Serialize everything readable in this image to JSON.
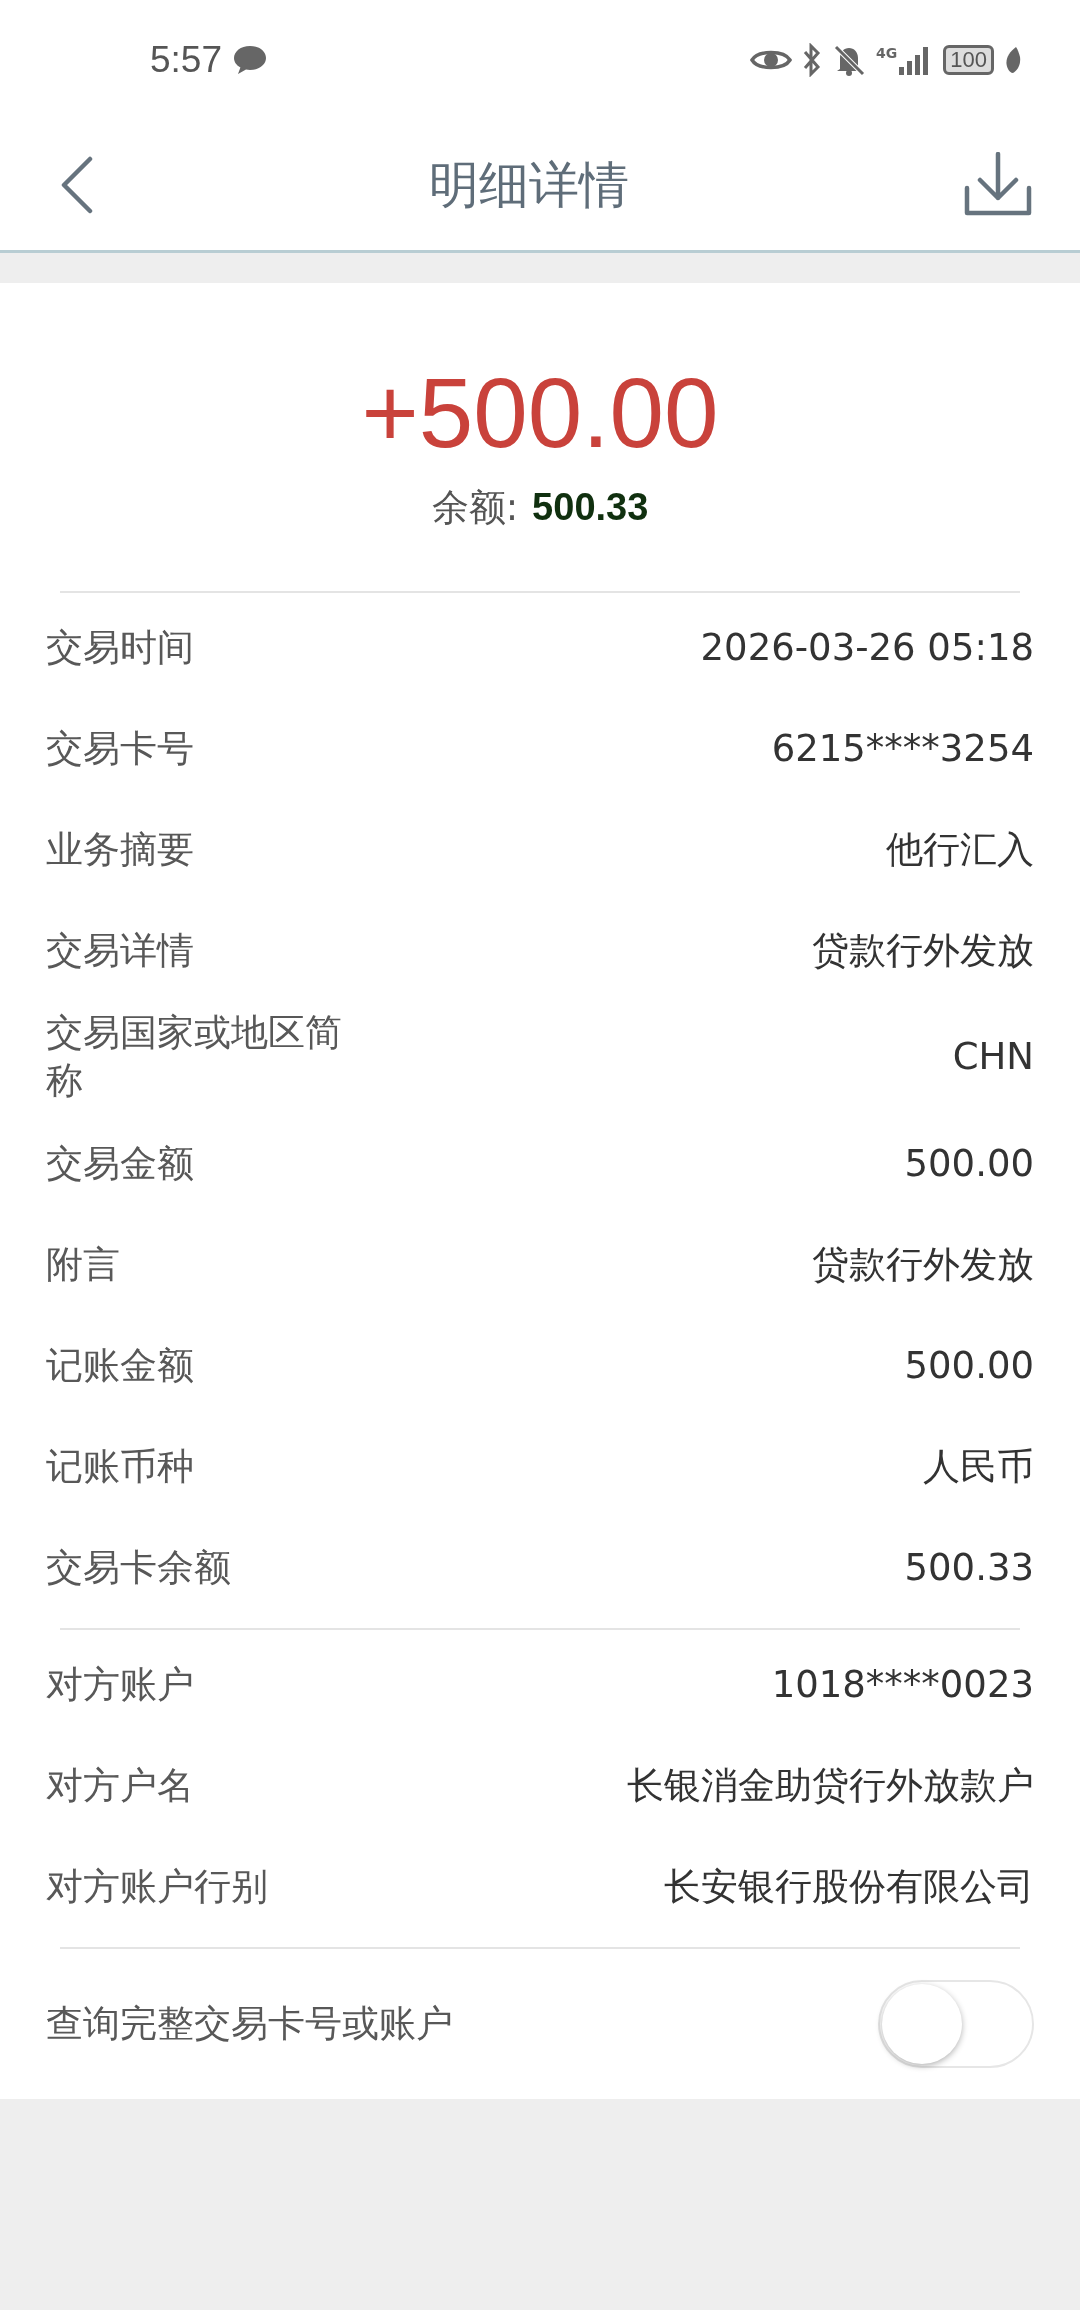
{
  "status_bar": {
    "time": "5:57",
    "network": "4G",
    "battery": "100"
  },
  "header": {
    "title": "明细详情"
  },
  "amount": "+500.00",
  "balance": {
    "label": "余额:",
    "value": "500.33"
  },
  "sections": [
    {
      "rows": [
        {
          "label": "交易时间",
          "value": "2026-03-26 05:18"
        },
        {
          "label": "交易卡号",
          "value": "6215****3254"
        },
        {
          "label": "业务摘要",
          "value": "他行汇入"
        },
        {
          "label": "交易详情",
          "value": "贷款行外发放"
        },
        {
          "label": "交易国家或地区简称",
          "value": "CHN"
        },
        {
          "label": "交易金额",
          "value": "500.00"
        },
        {
          "label": "附言",
          "value": "贷款行外发放"
        },
        {
          "label": "记账金额",
          "value": "500.00"
        },
        {
          "label": "记账币种",
          "value": "人民币"
        },
        {
          "label": "交易卡余额",
          "value": "500.33"
        }
      ]
    },
    {
      "rows": [
        {
          "label": "对方账户",
          "value": "1018****0023"
        },
        {
          "label": "对方户名",
          "value": "长银消金助贷行外放款户"
        },
        {
          "label": "对方账户行别",
          "value": "长安银行股份有限公司"
        }
      ]
    }
  ],
  "toggle": {
    "label": "查询完整交易卡号或账户",
    "on": false
  }
}
